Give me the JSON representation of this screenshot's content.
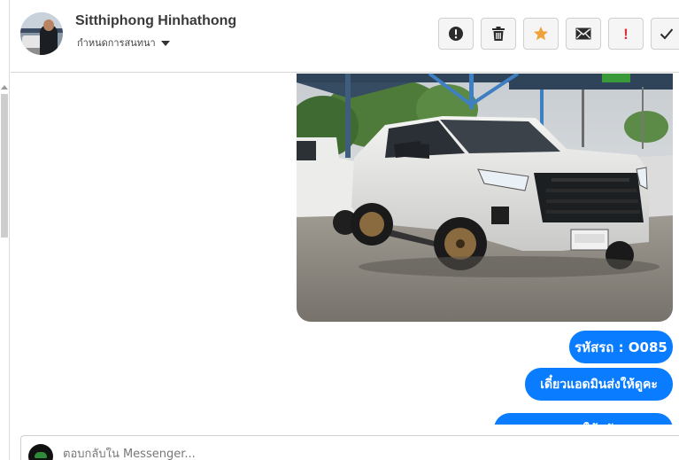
{
  "conversation": {
    "contact_name": "Sitthiphong Hinhathong",
    "assign_label": "กำหนดการสนทนา"
  },
  "toolbar": {
    "buttons": [
      {
        "name": "mark-spam",
        "icon": "alert-circle-icon"
      },
      {
        "name": "delete",
        "icon": "trash-icon"
      },
      {
        "name": "star",
        "icon": "star-icon",
        "color": "#f0a23a"
      },
      {
        "name": "mark-unread",
        "icon": "envelope-icon"
      },
      {
        "name": "follow-up",
        "icon": "exclamation-icon",
        "color": "#e0313b"
      },
      {
        "name": "mark-done",
        "icon": "check-icon"
      }
    ]
  },
  "messages": [
    {
      "type": "image",
      "icon": "photo-white-pickup-truck"
    },
    {
      "type": "text",
      "text": "รหัสรถ : O085"
    },
    {
      "type": "text",
      "text": "เดี๋ยวแอดมินส่งให้ดูคะ"
    },
    {
      "type": "text",
      "text": "ตาม...ใช้ครับ"
    }
  ],
  "composer": {
    "placeholder": "ตอบกลับใน Messenger..."
  },
  "colors": {
    "bubble": "#0a7cff",
    "star": "#f0a23a",
    "alert": "#e0313b"
  }
}
